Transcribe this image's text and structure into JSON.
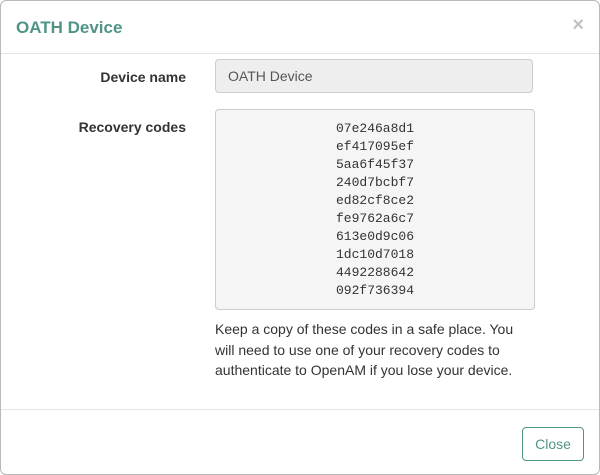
{
  "dialog": {
    "title": "OATH Device",
    "close_icon": "×"
  },
  "form": {
    "device_name_label": "Device name",
    "device_name_value": "OATH Device",
    "recovery_codes_label": "Recovery codes",
    "recovery_codes": [
      "07e246a8d1",
      "ef417095ef",
      "5aa6f45f37",
      "240d7bcbf7",
      "ed82cf8ce2",
      "fe9762a6c7",
      "613e0d9c06",
      "1dc10d7018",
      "4492288642",
      "092f736394"
    ],
    "help_text": "Keep a copy of these codes in a safe place. You will need to use one of your recovery codes to authenticate to OpenAM if you lose your device."
  },
  "footer": {
    "close_label": "Close"
  },
  "colors": {
    "accent": "#519387",
    "input_bg": "#eeeeee",
    "codes_bg": "#f5f5f5"
  }
}
